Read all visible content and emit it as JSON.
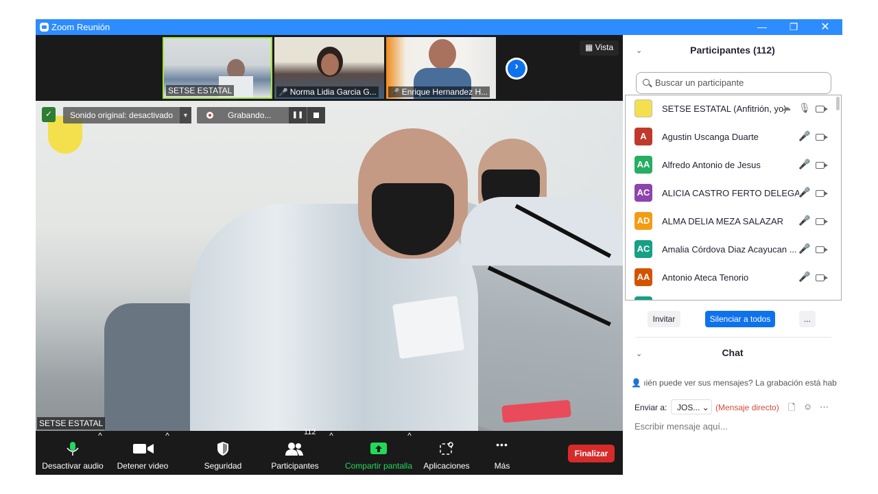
{
  "window": {
    "title": "Zoom Reunión",
    "minimize": "—",
    "restore": "❐",
    "close": "✕"
  },
  "thumbnails": [
    {
      "name": "SETSE ESTATAL",
      "muted": false
    },
    {
      "name": "Norma Lidia Garcia G...",
      "muted": true
    },
    {
      "name": "Enrique Hernandez H...",
      "muted": true
    }
  ],
  "view_button": "Vista",
  "next_arrow": "›",
  "video_overlay": {
    "original_sound": "Sonido original: desactivado",
    "recording": "Grabando...",
    "pause_glyph": "❚❚",
    "speaker_name": "SETSE ESTATAL"
  },
  "toolbar": {
    "audio": "Desactivar audio",
    "video": "Detener video",
    "security": "Seguridad",
    "participants": "Participantes",
    "participant_count": "112",
    "share": "Compartir pantalla",
    "apps": "Aplicaciones",
    "more": "Más",
    "end": "Finalizar",
    "caret": "^",
    "more_glyph": "•••"
  },
  "colors": {
    "accent": "#0e72ed",
    "share_green": "#23d959",
    "end_red": "#d52b2b",
    "muted_red": "#d83030"
  },
  "participants_panel": {
    "title": "Participantes (112)",
    "search_placeholder": "Buscar un participante",
    "list": [
      {
        "initials": "",
        "name": "SETSE ESTATAL (Anfitrión, yo)",
        "color": "#c7c7c7",
        "muted": false,
        "host": true
      },
      {
        "initials": "A",
        "name": "Agustin Uscanga Duarte",
        "color": "#c0392b",
        "muted": true
      },
      {
        "initials": "AA",
        "name": "Alfredo Antonio de Jesus",
        "color": "#27ae60",
        "muted": true
      },
      {
        "initials": "AC",
        "name": "ALICIA CASTRO FERTO DELEGAC...",
        "color": "#8e44ad",
        "muted": true
      },
      {
        "initials": "AD",
        "name": "ALMA DELIA MEZA SALAZAR",
        "color": "#f39c12",
        "muted": true
      },
      {
        "initials": "AC",
        "name": "Amalia Córdova Diaz Acayucan ...",
        "color": "#16a085",
        "muted": true
      },
      {
        "initials": "AA",
        "name": "Antonio Ateca Tenorio",
        "color": "#d35400",
        "muted": true
      }
    ],
    "invite": "Invitar",
    "mute_all": "Silenciar a todos",
    "more": "...",
    "collapse_glyph": "⌄"
  },
  "chat": {
    "title": "Chat",
    "notice": "ıién puede ver sus mensajes? La grabación está habilit",
    "send_to_label": "Enviar a:",
    "recipient": "JOS...",
    "direct": "(Mensaje directo)",
    "input_placeholder": "Escribir mensaje aquí...",
    "more": "···"
  }
}
